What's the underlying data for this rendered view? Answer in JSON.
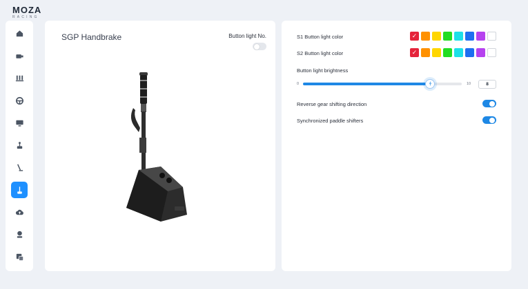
{
  "brand": {
    "name": "MOZA",
    "sub": "RACING"
  },
  "sidebar": {
    "items": [
      {
        "icon": "home-icon",
        "active": false
      },
      {
        "icon": "wheelbase-icon",
        "active": false
      },
      {
        "icon": "pedals-icon",
        "active": false
      },
      {
        "icon": "steering-wheel-icon",
        "active": false
      },
      {
        "icon": "dashboard-icon",
        "active": false
      },
      {
        "icon": "shifter-icon",
        "active": false
      },
      {
        "icon": "handbrake-icon",
        "active": false
      },
      {
        "icon": "sgp-handbrake-icon",
        "active": true
      },
      {
        "icon": "cloud-upload-icon",
        "active": false
      },
      {
        "icon": "user-icon",
        "active": false
      },
      {
        "icon": "settings-device-icon",
        "active": false
      }
    ]
  },
  "left_panel": {
    "title": "SGP Handbrake",
    "button_light_label": "Button light No.",
    "button_light_enabled": false
  },
  "right_panel": {
    "s1_label": "S1 Button light color",
    "s2_label": "S2 Button light color",
    "colors": [
      "#e5243b",
      "#ff9100",
      "#ffd600",
      "#22dd22",
      "#1ce0e8",
      "#1e6ef0",
      "#b642ef",
      "#ffffff"
    ],
    "s1_selected_index": 0,
    "s2_selected_index": 0,
    "brightness_label": "Button light brightness",
    "brightness_min": "0",
    "brightness_max": "10",
    "brightness_value": "8",
    "brightness_fraction": 0.8,
    "reverse_label": "Reverse gear shifting direction",
    "reverse_enabled": true,
    "paddle_label": "Synchronized paddle shifters",
    "paddle_enabled": true
  },
  "accent_color": "#1e88e5"
}
